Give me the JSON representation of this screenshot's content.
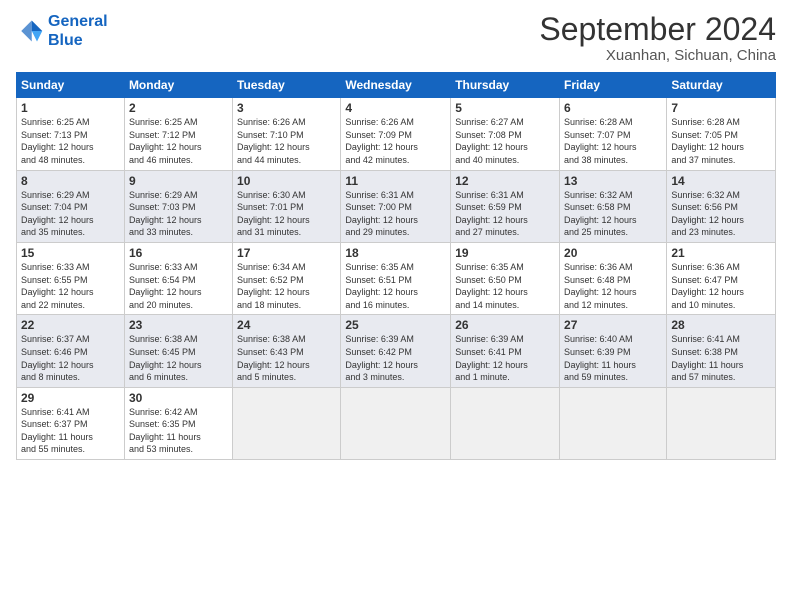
{
  "header": {
    "logo_line1": "General",
    "logo_line2": "Blue",
    "month_title": "September 2024",
    "subtitle": "Xuanhan, Sichuan, China"
  },
  "days_of_week": [
    "Sunday",
    "Monday",
    "Tuesday",
    "Wednesday",
    "Thursday",
    "Friday",
    "Saturday"
  ],
  "weeks": [
    [
      {
        "day": "1",
        "sunrise": "6:25 AM",
        "sunset": "7:13 PM",
        "daylight": "12 hours and 48 minutes."
      },
      {
        "day": "2",
        "sunrise": "6:25 AM",
        "sunset": "7:12 PM",
        "daylight": "12 hours and 46 minutes."
      },
      {
        "day": "3",
        "sunrise": "6:26 AM",
        "sunset": "7:10 PM",
        "daylight": "12 hours and 44 minutes."
      },
      {
        "day": "4",
        "sunrise": "6:26 AM",
        "sunset": "7:09 PM",
        "daylight": "12 hours and 42 minutes."
      },
      {
        "day": "5",
        "sunrise": "6:27 AM",
        "sunset": "7:08 PM",
        "daylight": "12 hours and 40 minutes."
      },
      {
        "day": "6",
        "sunrise": "6:28 AM",
        "sunset": "7:07 PM",
        "daylight": "12 hours and 38 minutes."
      },
      {
        "day": "7",
        "sunrise": "6:28 AM",
        "sunset": "7:05 PM",
        "daylight": "12 hours and 37 minutes."
      }
    ],
    [
      {
        "day": "8",
        "sunrise": "6:29 AM",
        "sunset": "7:04 PM",
        "daylight": "12 hours and 35 minutes."
      },
      {
        "day": "9",
        "sunrise": "6:29 AM",
        "sunset": "7:03 PM",
        "daylight": "12 hours and 33 minutes."
      },
      {
        "day": "10",
        "sunrise": "6:30 AM",
        "sunset": "7:01 PM",
        "daylight": "12 hours and 31 minutes."
      },
      {
        "day": "11",
        "sunrise": "6:31 AM",
        "sunset": "7:00 PM",
        "daylight": "12 hours and 29 minutes."
      },
      {
        "day": "12",
        "sunrise": "6:31 AM",
        "sunset": "6:59 PM",
        "daylight": "12 hours and 27 minutes."
      },
      {
        "day": "13",
        "sunrise": "6:32 AM",
        "sunset": "6:58 PM",
        "daylight": "12 hours and 25 minutes."
      },
      {
        "day": "14",
        "sunrise": "6:32 AM",
        "sunset": "6:56 PM",
        "daylight": "12 hours and 23 minutes."
      }
    ],
    [
      {
        "day": "15",
        "sunrise": "6:33 AM",
        "sunset": "6:55 PM",
        "daylight": "12 hours and 22 minutes."
      },
      {
        "day": "16",
        "sunrise": "6:33 AM",
        "sunset": "6:54 PM",
        "daylight": "12 hours and 20 minutes."
      },
      {
        "day": "17",
        "sunrise": "6:34 AM",
        "sunset": "6:52 PM",
        "daylight": "12 hours and 18 minutes."
      },
      {
        "day": "18",
        "sunrise": "6:35 AM",
        "sunset": "6:51 PM",
        "daylight": "12 hours and 16 minutes."
      },
      {
        "day": "19",
        "sunrise": "6:35 AM",
        "sunset": "6:50 PM",
        "daylight": "12 hours and 14 minutes."
      },
      {
        "day": "20",
        "sunrise": "6:36 AM",
        "sunset": "6:48 PM",
        "daylight": "12 hours and 12 minutes."
      },
      {
        "day": "21",
        "sunrise": "6:36 AM",
        "sunset": "6:47 PM",
        "daylight": "12 hours and 10 minutes."
      }
    ],
    [
      {
        "day": "22",
        "sunrise": "6:37 AM",
        "sunset": "6:46 PM",
        "daylight": "12 hours and 8 minutes."
      },
      {
        "day": "23",
        "sunrise": "6:38 AM",
        "sunset": "6:45 PM",
        "daylight": "12 hours and 6 minutes."
      },
      {
        "day": "24",
        "sunrise": "6:38 AM",
        "sunset": "6:43 PM",
        "daylight": "12 hours and 5 minutes."
      },
      {
        "day": "25",
        "sunrise": "6:39 AM",
        "sunset": "6:42 PM",
        "daylight": "12 hours and 3 minutes."
      },
      {
        "day": "26",
        "sunrise": "6:39 AM",
        "sunset": "6:41 PM",
        "daylight": "12 hours and 1 minute."
      },
      {
        "day": "27",
        "sunrise": "6:40 AM",
        "sunset": "6:39 PM",
        "daylight": "11 hours and 59 minutes."
      },
      {
        "day": "28",
        "sunrise": "6:41 AM",
        "sunset": "6:38 PM",
        "daylight": "11 hours and 57 minutes."
      }
    ],
    [
      {
        "day": "29",
        "sunrise": "6:41 AM",
        "sunset": "6:37 PM",
        "daylight": "11 hours and 55 minutes."
      },
      {
        "day": "30",
        "sunrise": "6:42 AM",
        "sunset": "6:35 PM",
        "daylight": "11 hours and 53 minutes."
      },
      null,
      null,
      null,
      null,
      null
    ]
  ]
}
